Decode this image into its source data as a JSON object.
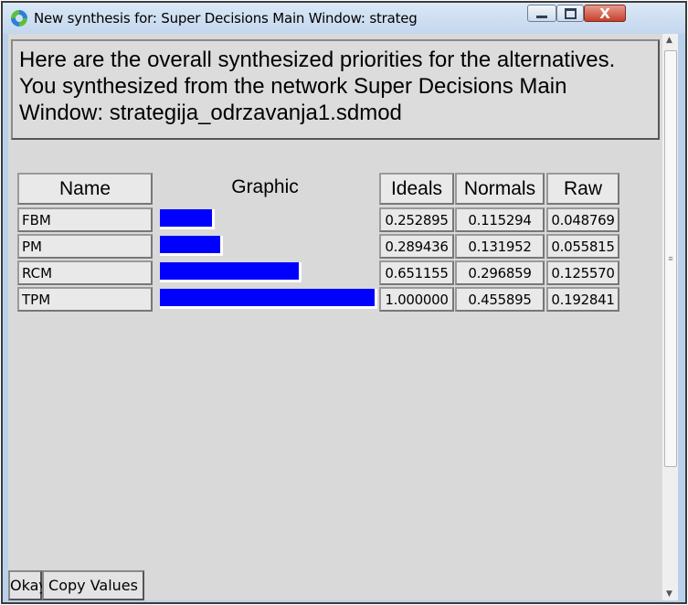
{
  "window": {
    "title": "New synthesis for: Super Decisions Main Window: strategija_o...",
    "buttons": {
      "minimize": "minimize-icon",
      "maximize": "maximize-icon",
      "close": "X"
    }
  },
  "message": "Here are the overall synthesized priorities for the alternatives.  You synthesized from the network Super Decisions Main Window: strategija_odrzavanja1.sdmod",
  "table": {
    "headers": {
      "name": "Name",
      "graphic": "Graphic",
      "ideals": "Ideals",
      "normals": "Normals",
      "raw": "Raw"
    },
    "rows": [
      {
        "name": "FBM",
        "ideal": "0.252895",
        "normal": "0.115294",
        "raw": "0.048769",
        "bar_fraction": 0.252895
      },
      {
        "name": "PM",
        "ideal": "0.289436",
        "normal": "0.131952",
        "raw": "0.055815",
        "bar_fraction": 0.289436
      },
      {
        "name": "RCM",
        "ideal": "0.651155",
        "normal": "0.296859",
        "raw": "0.125570",
        "bar_fraction": 0.651155
      },
      {
        "name": "TPM",
        "ideal": "1.000000",
        "normal": "0.455895",
        "raw": "0.192841",
        "bar_fraction": 1.0
      }
    ]
  },
  "actions": {
    "okay": "Okay",
    "copy": "Copy Values"
  },
  "colors": {
    "bar": "#0000ff",
    "background": "#d9d9d9"
  }
}
